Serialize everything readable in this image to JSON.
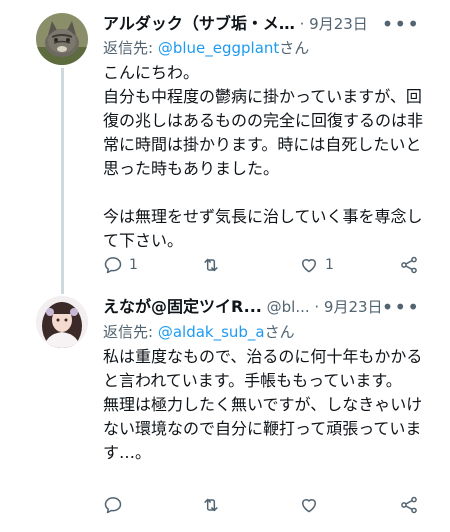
{
  "tweets": [
    {
      "name": "アルダック（サブ垢・メ…",
      "meta": " · 9月23日",
      "reply_prefix": "返信先: ",
      "reply_handle": "@blue_eggplant",
      "reply_suffix": "さん",
      "body": "こんにちわ。\n自分も中程度の鬱病に掛かっていますが、回復の兆しはあるものの完全に回復するのは非常に時間は掛かります。時には自死したいと思った時もありました。\n\n今は無理をせず気長に治していく事を専念して下さい。",
      "replies": "1",
      "retweets": "",
      "likes": "1",
      "more": "•••"
    },
    {
      "name": "えなが@固定ツイR...",
      "meta": " @bl... · 9月23日",
      "reply_prefix": "返信先: ",
      "reply_handle": "@aldak_sub_a",
      "reply_suffix": "さん",
      "body": "私は重度なもので、治るのに何十年もかかると言われています。手帳ももっています。\n無理は極力したく無いですが、しなきゃいけない環境なので自分に鞭打って頑張っています…。",
      "replies": "",
      "retweets": "",
      "likes": "",
      "more": "•••"
    }
  ],
  "colors": {
    "link": "#1d9bf0",
    "muted": "#536471",
    "line": "#cfd9de"
  },
  "icons": [
    "reply-icon",
    "retweet-icon",
    "like-icon",
    "share-icon",
    "more-icon"
  ]
}
